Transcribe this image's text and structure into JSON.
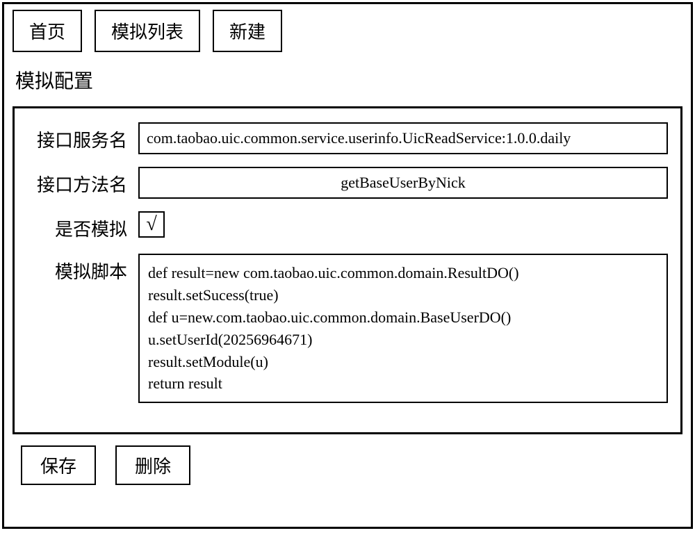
{
  "nav": {
    "home": "首页",
    "mock_list": "模拟列表",
    "new": "新建"
  },
  "section_title": "模拟配置",
  "form": {
    "service_name_label": "接口服务名",
    "service_name_value": "com.taobao.uic.common.service.userinfo.UicReadService:1.0.0.daily",
    "method_name_label": "接口方法名",
    "method_name_value": "getBaseUserByNick",
    "is_mock_label": "是否模拟",
    "is_mock_checked": "√",
    "script_label": "模拟脚本",
    "script_value": "def result=new com.taobao.uic.common.domain.ResultDO()\nresult.setSucess(true)\ndef u=new.com.taobao.uic.common.domain.BaseUserDO()\nu.setUserId(20256964671)\nresult.setModule(u)\nreturn result"
  },
  "actions": {
    "save": "保存",
    "delete": "删除"
  }
}
